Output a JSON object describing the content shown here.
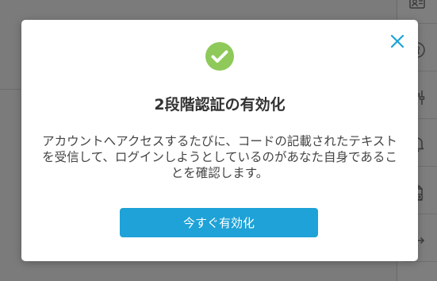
{
  "modal": {
    "title": "2段階認証の有効化",
    "description": "アカウントへアクセスするたびに、コードの記載されたテキストを受信して、ログインしようとしているのがあなた自身であることを確認します。",
    "enable_button_label": "今すぐ有効化",
    "icons": {
      "status": "check-circle-icon",
      "close": "close-icon"
    }
  },
  "sidebar": {
    "icons": [
      "contact-card-icon",
      "keyhole-icon",
      "sliders-icon",
      "bell-icon",
      "add-document-icon",
      "logout-icon"
    ]
  },
  "colors": {
    "accent": "#1ea2d7",
    "success": "#8ec95a",
    "overlay": "#7b7b7b",
    "close": "#1ea2d7"
  }
}
